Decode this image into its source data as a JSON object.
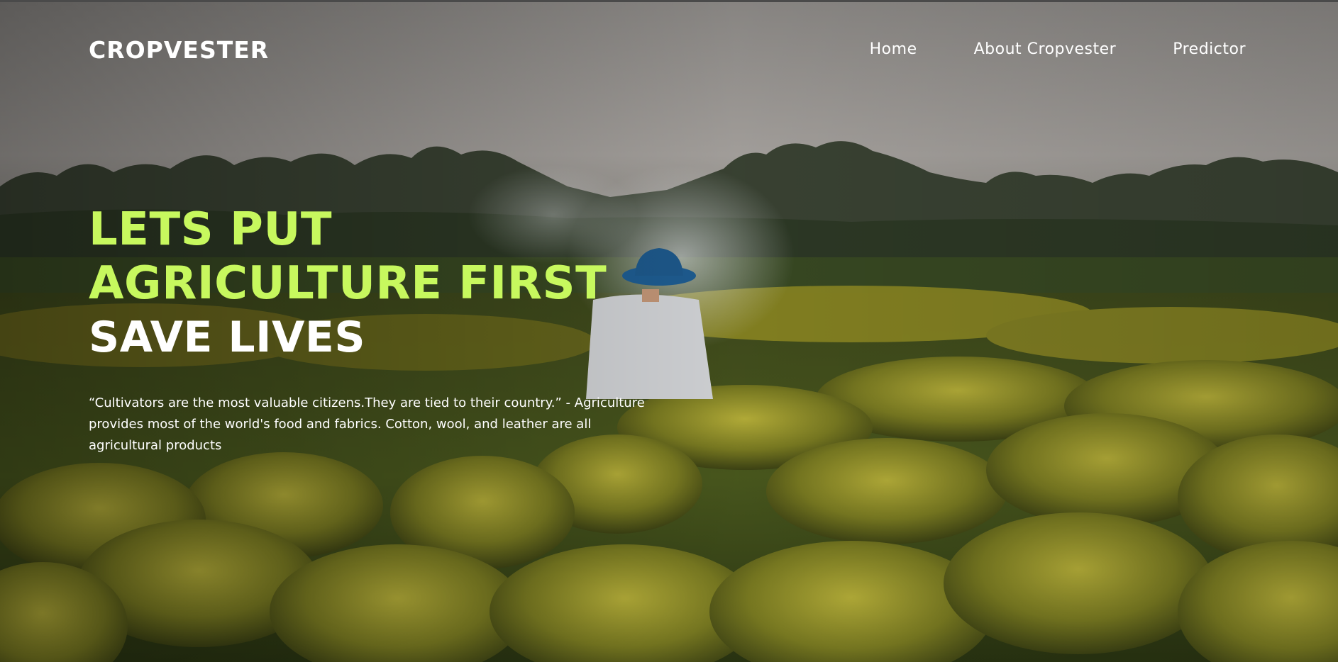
{
  "brand": {
    "name": "CROPVESTER"
  },
  "nav": {
    "items": [
      {
        "label": "Home"
      },
      {
        "label": "About Cropvester"
      },
      {
        "label": "Predictor"
      }
    ]
  },
  "hero": {
    "headline_line1": "LETS PUT",
    "headline_line2": "AGRICULTURE FIRST",
    "headline_line3": "SAVE LIVES",
    "quote_part1": "“Cultivators are the most valuable citizens.They are tied to their country.” -",
    "quote_part2": "Agriculture provides most of the world's food and fabrics. Cotton, wool, and leather are all agricultural products"
  },
  "colors": {
    "accent_green": "#c7f85e",
    "text_white": "#ffffff",
    "sky": "#9e9a96"
  }
}
